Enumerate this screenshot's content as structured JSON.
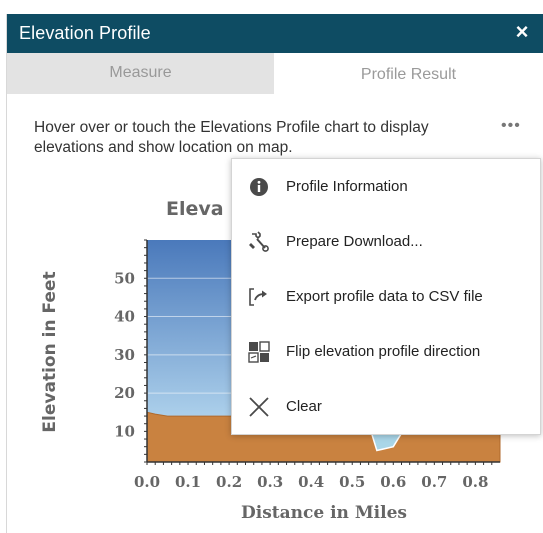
{
  "window": {
    "title": "Elevation Profile",
    "close_label": "×"
  },
  "tabs": [
    {
      "label": "Measure",
      "active": false
    },
    {
      "label": "Profile Result",
      "active": true
    }
  ],
  "instructions": "Hover over or touch the Elevations Profile chart to display elevations and show location on map.",
  "more_label": "•••",
  "menu": {
    "items": [
      {
        "label": "Profile Information",
        "icon": "info-icon"
      },
      {
        "label": "Prepare Download...",
        "icon": "wrench-icon"
      },
      {
        "label": "Export profile data to CSV file",
        "icon": "export-icon"
      },
      {
        "label": "Flip elevation profile direction",
        "icon": "flip-icon"
      },
      {
        "label": "Clear",
        "icon": "close-icon"
      }
    ]
  },
  "colors": {
    "titlebar": "#0e4c63",
    "terrain": "#c98240",
    "water": "#a9d6e8",
    "sky_top": "#4a79bb",
    "sky_bottom": "#c5e6f7"
  },
  "chart_data": {
    "type": "area",
    "title": "Eleva",
    "xlabel": "Distance in Miles",
    "ylabel": "Elevation in Feet",
    "xlim": [
      0.0,
      0.86
    ],
    "ylim": [
      2,
      60
    ],
    "x_ticks": [
      "0.0",
      "0.1",
      "0.2",
      "0.3",
      "0.4",
      "0.5",
      "0.6",
      "0.7",
      "0.8"
    ],
    "y_ticks": [
      "10",
      "20",
      "30",
      "40",
      "50"
    ],
    "y_tick_values": [
      10,
      20,
      30,
      40,
      50
    ],
    "x_tick_values": [
      0.0,
      0.1,
      0.2,
      0.3,
      0.4,
      0.5,
      0.6,
      0.7,
      0.8
    ],
    "series": [
      {
        "x": [
          0.0,
          0.02,
          0.05,
          0.1,
          0.15,
          0.2,
          0.25,
          0.3,
          0.35,
          0.4,
          0.45,
          0.5,
          0.54,
          0.56,
          0.6,
          0.64,
          0.7,
          0.75,
          0.8,
          0.86
        ],
        "y": [
          15,
          14.5,
          14,
          14,
          14,
          14,
          14,
          14,
          14,
          14,
          14,
          14,
          12,
          5,
          6,
          13,
          13,
          13,
          13,
          13
        ]
      }
    ]
  }
}
